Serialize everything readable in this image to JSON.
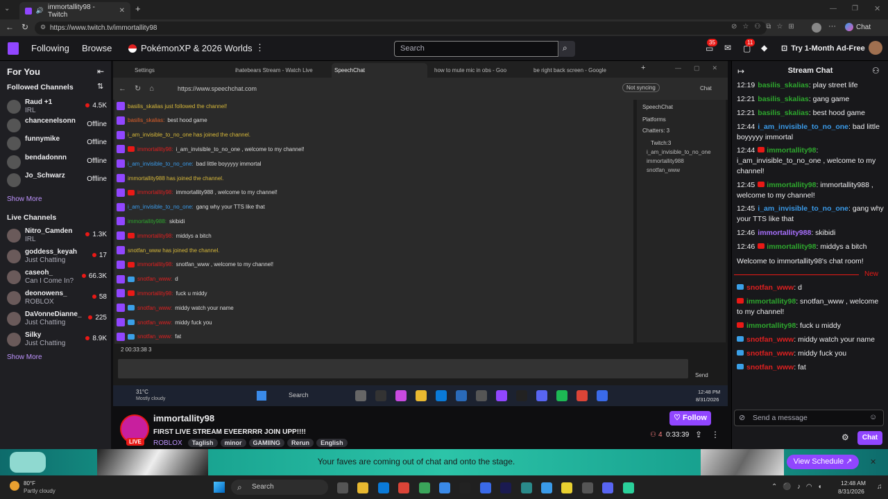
{
  "browser": {
    "tab_title": "immortallity98 - Twitch",
    "url": "https://www.twitch.tv/immortallity98",
    "chat_label": "Chat"
  },
  "twitch_nav": {
    "following": "Following",
    "browse": "Browse",
    "promo": "PokémonXP & 2026 Worlds",
    "search_placeholder": "Search",
    "notif_count": "35",
    "alerts_count": "11",
    "adfree": "Try 1-Month Ad-Free"
  },
  "sidebar": {
    "for_you": "For You",
    "followed_header": "Followed Channels",
    "followed": [
      {
        "name": "Raud +1",
        "sub": "IRL",
        "viewers": "4.5K",
        "live": true
      },
      {
        "name": "chancenelsonn",
        "sub": "",
        "viewers": "Offline",
        "live": false
      },
      {
        "name": "funnymike",
        "sub": "",
        "viewers": "Offline",
        "live": false
      },
      {
        "name": "bendadonnn",
        "sub": "",
        "viewers": "Offline",
        "live": false
      },
      {
        "name": "Jo_Schwarz",
        "sub": "",
        "viewers": "Offline",
        "live": false
      }
    ],
    "show_more_1": "Show More",
    "live_header": "Live Channels",
    "live": [
      {
        "name": "Nitro_Camden",
        "sub": "IRL",
        "viewers": "1.3K"
      },
      {
        "name": "goddess_keyah",
        "sub": "Just Chatting",
        "viewers": "17"
      },
      {
        "name": "caseoh_",
        "sub": "Can I Come In?",
        "viewers": "66.3K"
      },
      {
        "name": "deonowens_",
        "sub": "ROBLOX",
        "viewers": "58"
      },
      {
        "name": "DaVonneDianne_",
        "sub": "Just Chatting",
        "viewers": "225"
      },
      {
        "name": "Silky",
        "sub": "Just Chatting",
        "viewers": "8.9K"
      }
    ],
    "show_more_2": "Show More"
  },
  "inner_browser": {
    "tabs": [
      "Settings",
      "ihatebears Stream - Watch Live",
      "SpeechChat",
      "how to mute mic in obs - Goo",
      "be right back screen - Google"
    ],
    "url": "https://www.speechchat.com",
    "not_syncing": "Not syncing",
    "chat": "Chat"
  },
  "speechchat": {
    "messages": [
      {
        "p": "tw",
        "user": "",
        "text": "basilis_skalias just followed the channel!",
        "uc": "",
        "tc": "#d8b93a"
      },
      {
        "p": "tw",
        "user": "basilis_skalias:",
        "text": "best hood game",
        "uc": "#e0602a",
        "tc": "#ddd"
      },
      {
        "p": "tw",
        "user": "",
        "text": "i_am_invisible_to_no_one has joined the channel.",
        "uc": "",
        "tc": "#d8b93a"
      },
      {
        "p": "yt",
        "user": "immortallity98:",
        "text": "i_am_invisible_to_no_one , welcome to my channel!",
        "uc": "#e02020",
        "tc": "#ddd"
      },
      {
        "p": "tw",
        "user": "i_am_invisible_to_no_one:",
        "text": "bad little boyyyyy immortal",
        "uc": "#3a9ae8",
        "tc": "#ddd"
      },
      {
        "p": "tw",
        "user": "",
        "text": "immortallity988 has joined the channel.",
        "uc": "",
        "tc": "#d8b93a"
      },
      {
        "p": "yt",
        "user": "immortallity98:",
        "text": "immortallity988 , welcome to my channel!",
        "uc": "#e02020",
        "tc": "#ddd"
      },
      {
        "p": "tw",
        "user": "i_am_invisible_to_no_one:",
        "text": "gang why your TTS like that",
        "uc": "#3a9ae8",
        "tc": "#ddd"
      },
      {
        "p": "tw",
        "user": "immortallity988:",
        "text": "skibidi",
        "uc": "#2ea82e",
        "tc": "#ddd"
      },
      {
        "p": "yt",
        "user": "immortallity98:",
        "text": "middys a bitch",
        "uc": "#e02020",
        "tc": "#ddd"
      },
      {
        "p": "tw",
        "user": "",
        "text": "snotfan_www has joined the channel.",
        "uc": "",
        "tc": "#d8b93a"
      },
      {
        "p": "yt",
        "user": "immortallity98:",
        "text": "snotfan_www , welcome to my channel!",
        "uc": "#e02020",
        "tc": "#ddd"
      },
      {
        "p": "kk",
        "user": "snotfan_www:",
        "text": "d",
        "uc": "#e02020",
        "tc": "#ddd"
      },
      {
        "p": "yt",
        "user": "immortallity98:",
        "text": "fuck u middy",
        "uc": "#e02020",
        "tc": "#ddd"
      },
      {
        "p": "kk",
        "user": "snotfan_www:",
        "text": "middy watch your name",
        "uc": "#e02020",
        "tc": "#ddd"
      },
      {
        "p": "kk",
        "user": "snotfan_www:",
        "text": "middy fuck you",
        "uc": "#e02020",
        "tc": "#ddd"
      },
      {
        "p": "kk",
        "user": "snotfan_www:",
        "text": "fat",
        "uc": "#e02020",
        "tc": "#ddd"
      }
    ],
    "stats": "2  00:33:38  3",
    "side_title": "SpeechChat",
    "platforms": "Platforms",
    "chatters": "Chatters: 3",
    "twitch_count": "Twitch:3",
    "chatter_names": [
      "i_am_invisible_to_no_one",
      "immortallity988",
      "snotfan_www"
    ],
    "send": "Send"
  },
  "inner_taskbar": {
    "temp": "31°C",
    "weather": "Mostly cloudy",
    "search": "Search",
    "time": "12:48 PM",
    "date": "8/31/2026"
  },
  "stream": {
    "channel": "immortallity98",
    "title": "FIRST LIVE STREAM EVEERRRR JOIN UPP!!!!",
    "category": "ROBLOX",
    "tags": [
      "Taglish",
      "minor",
      "GAMIING",
      "Rerun",
      "English"
    ],
    "live": "LIVE",
    "viewers": "4",
    "uptime": "0:33:39",
    "follow": "Follow"
  },
  "chat": {
    "header": "Stream Chat",
    "messages": [
      {
        "t": "12:19",
        "user": "basilis_skalias",
        "uc": "#2ea82e",
        "text": ": play street life",
        "yt": false
      },
      {
        "t": "12:21",
        "user": "basilis_skalias",
        "uc": "#2ea82e",
        "text": ": gang game",
        "yt": false
      },
      {
        "t": "12:21",
        "user": "basilis_skalias",
        "uc": "#2ea82e",
        "text": ": best hood game",
        "yt": false
      },
      {
        "t": "12:44",
        "user": "i_am_invisible_to_no_one",
        "uc": "#3a9ae8",
        "text": ": bad little boyyyyy immortal",
        "yt": false
      },
      {
        "t": "12:44",
        "user": "immortallity98",
        "uc": "#2ea82e",
        "text": ": i_am_invisible_to_no_one , welcome to my channel!",
        "yt": true
      },
      {
        "t": "12:45",
        "user": "immortallity98",
        "uc": "#2ea82e",
        "text": ": immortallity988 , welcome to my channel!",
        "yt": true
      },
      {
        "t": "12:45",
        "user": "i_am_invisible_to_no_one",
        "uc": "#3a9ae8",
        "text": ": gang why your TTS like that",
        "yt": false
      },
      {
        "t": "12:46",
        "user": "immortallity988",
        "uc": "#a970ff",
        "text": ": skibidi",
        "yt": false
      },
      {
        "t": "12:46",
        "user": "immortallity98",
        "uc": "#2ea82e",
        "text": ": middys a bitch",
        "yt": true
      }
    ],
    "welcome": "Welcome to immortallity98's chat room!",
    "new_label": "New",
    "new_messages": [
      {
        "user": "snotfan_www",
        "uc": "#e02020",
        "text": ": d",
        "p": "kk"
      },
      {
        "user": "immortallity98",
        "uc": "#2ea82e",
        "text": ": snotfan_www , welcome to my channel!",
        "p": "yt"
      },
      {
        "user": "immortallity98",
        "uc": "#2ea82e",
        "text": ": fuck u middy",
        "p": "yt"
      },
      {
        "user": "snotfan_www",
        "uc": "#e02020",
        "text": ": middy watch your name",
        "p": "kk"
      },
      {
        "user": "snotfan_www",
        "uc": "#e02020",
        "text": ": middy fuck you",
        "p": "kk"
      },
      {
        "user": "snotfan_www",
        "uc": "#e02020",
        "text": ": fat",
        "p": "kk"
      }
    ],
    "send_placeholder": "Send a message",
    "chat_button": "Chat"
  },
  "banner": {
    "text": "Your faves are coming out of chat and onto the stage.",
    "schedule": "View Schedule"
  },
  "taskbar": {
    "temp": "80°F",
    "weather": "Partly cloudy",
    "search": "Search",
    "time": "12:48 AM",
    "date": "8/31/2026"
  },
  "colors": {
    "twitch_purple": "#9146ff",
    "live_red": "#e91916"
  }
}
